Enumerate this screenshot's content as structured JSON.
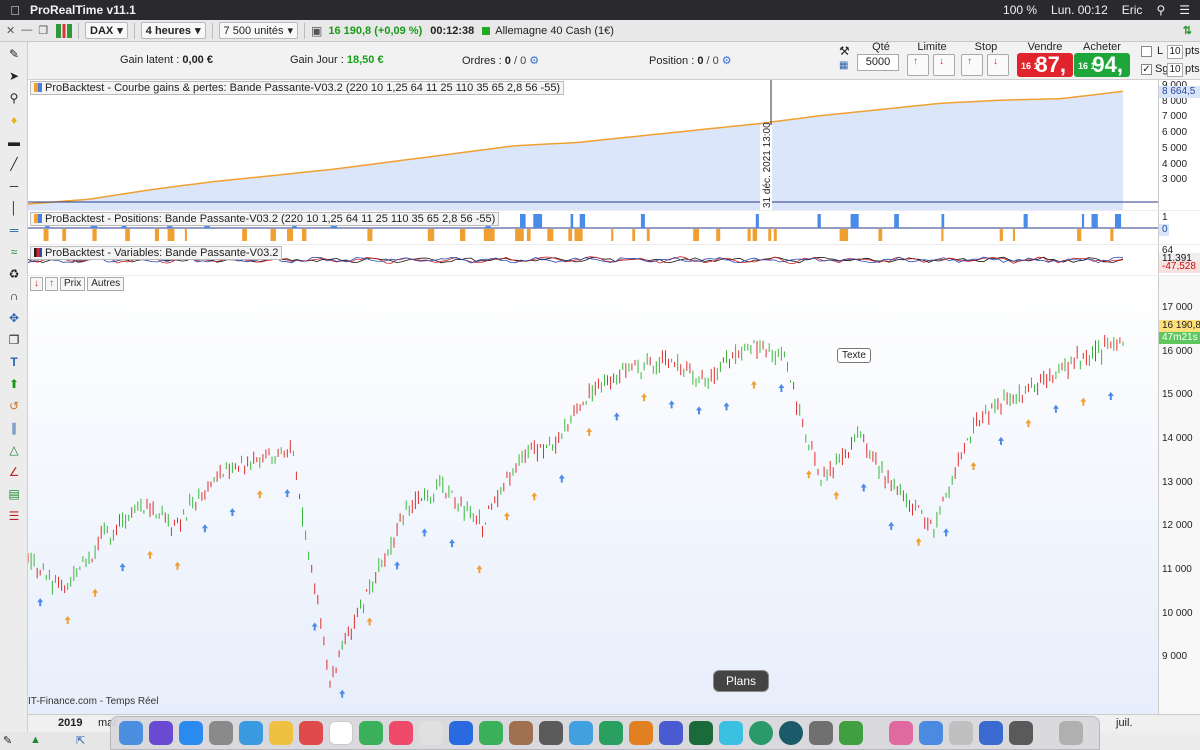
{
  "menubar": {
    "app_name": "ProRealTime v11.1",
    "battery": "100 %",
    "clock": "Lun. 00:12",
    "user": "Eric"
  },
  "toolbar": {
    "instrument": "DAX",
    "timeframe": "4 heures",
    "units": "7 500 unités",
    "price": "16 190,8 (+0,09 %)",
    "timer": "00:12:38",
    "market": "Allemagne 40 Cash (1€)"
  },
  "info": {
    "gain_latent_label": "Gain latent :",
    "gain_latent_value": "0,00 €",
    "gain_jour_label": "Gain Jour :",
    "gain_jour_value": "18,50 €",
    "ordres_label": "Ordres :",
    "ordres_a": "0",
    "ordres_b": "/ 0",
    "position_label": "Position :",
    "position_a": "0",
    "position_b": "/ 0"
  },
  "trade": {
    "qty_label": "Qté",
    "qty_value": "5000",
    "limite_label": "Limite",
    "stop_label": "Stop",
    "vendre_label": "Vendre",
    "acheter_label": "Acheter",
    "sell_prefix": "16 1",
    "sell_big": "87,",
    "buy_prefix": "16 1",
    "buy_big": "94,",
    "l_label": "L",
    "sg_label": "Sg",
    "pts1": "10",
    "pts2": "10",
    "pts_label": "pts"
  },
  "panels": {
    "equity_title": "ProBacktest - Courbe gains & pertes: Bande Passante-V03.2 (220 10 1,25 64 11 25 110 35 65 2,8 56 -55)",
    "positions_title": "ProBacktest - Positions: Bande Passante-V03.2 (220 10 1,25 64 11 25 110 35 65 2,8 56 -55)",
    "variables_title": "ProBacktest - Variables: Bande Passante-V03.2",
    "cursor_date": "31 déc. 2021 13:00",
    "main_tool_prix": "Prix",
    "main_tool_autres": "Autres",
    "texte_label": "Texte",
    "source": "IT-Finance.com - Temps Réel"
  },
  "equity_axis": {
    "ticks": [
      "9 000",
      "8 000",
      "7 000",
      "6 000",
      "5 000",
      "4 000",
      "3 000"
    ],
    "tag": "8 664,5"
  },
  "positions_axis": {
    "top": "1",
    "tag": "0"
  },
  "variables_axis": {
    "top": "64",
    "tag1": "11,391",
    "tag2": "-47,528"
  },
  "price_axis": {
    "ticks": [
      "17 000",
      "16 000",
      "15 000",
      "14 000",
      "13 000",
      "12 000",
      "11 000",
      "10 000",
      "9 000"
    ],
    "last_price": "16 190,8",
    "countdown": "47m21s"
  },
  "x_axis": {
    "labels": [
      "2019",
      "mar",
      "juil."
    ]
  },
  "dock": {
    "tooltip": "Plans"
  },
  "chart_data": [
    {
      "type": "area",
      "title": "ProBacktest - Courbe gains & pertes: Bande Passante-V03.2 (220 10 1,25 64 11 25 110 35 65 2,8 56 -55)",
      "x": [
        "2019-01",
        "2019-04",
        "2019-07",
        "2019-10",
        "2020-01",
        "2020-04",
        "2020-07",
        "2020-10",
        "2021-01",
        "2021-04",
        "2021-07",
        "2021-10",
        "2022-01",
        "2022-04",
        "2022-07",
        "2022-10",
        "2023-01",
        "2023-04",
        "2023-07"
      ],
      "values": [
        1500,
        1800,
        2400,
        2900,
        3300,
        3700,
        4200,
        4700,
        5200,
        5400,
        5800,
        6200,
        6600,
        7100,
        7500,
        7900,
        8100,
        8200,
        8664.5
      ],
      "ylim": [
        1500,
        9000
      ]
    },
    {
      "type": "line",
      "title": "DAX 4 heures",
      "x": [
        "2019-01",
        "2019-03",
        "2019-05",
        "2019-07",
        "2019-09",
        "2019-11",
        "2020-01",
        "2020-02",
        "2020-03",
        "2020-04",
        "2020-06",
        "2020-08",
        "2020-10",
        "2020-12",
        "2021-02",
        "2021-04",
        "2021-06",
        "2021-08",
        "2021-10",
        "2021-11",
        "2022-01",
        "2022-03",
        "2022-05",
        "2022-07",
        "2022-09",
        "2022-11",
        "2023-01",
        "2023-03",
        "2023-05",
        "2023-07"
      ],
      "values": [
        11200,
        10500,
        11800,
        12400,
        12100,
        13200,
        13500,
        13700,
        8500,
        10500,
        12400,
        12900,
        12000,
        13600,
        14000,
        15200,
        15600,
        15800,
        15300,
        16200,
        15900,
        13000,
        14100,
        12800,
        12000,
        14300,
        15000,
        15400,
        15900,
        16190.8
      ],
      "ylim": [
        8000,
        17500
      ]
    }
  ]
}
